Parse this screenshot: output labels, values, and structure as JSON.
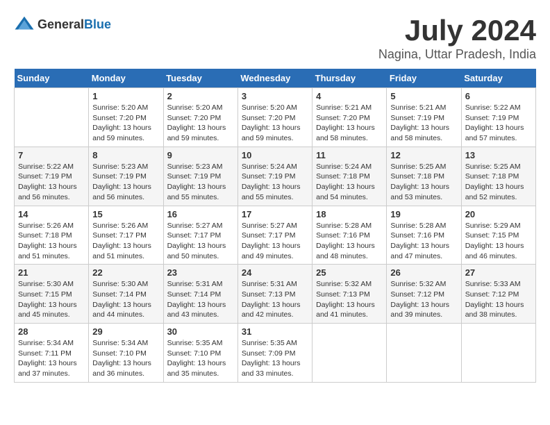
{
  "logo": {
    "general": "General",
    "blue": "Blue"
  },
  "title": "July 2024",
  "subtitle": "Nagina, Uttar Pradesh, India",
  "days_header": [
    "Sunday",
    "Monday",
    "Tuesday",
    "Wednesday",
    "Thursday",
    "Friday",
    "Saturday"
  ],
  "weeks": [
    [
      {
        "day": "",
        "info": ""
      },
      {
        "day": "1",
        "info": "Sunrise: 5:20 AM\nSunset: 7:20 PM\nDaylight: 13 hours\nand 59 minutes."
      },
      {
        "day": "2",
        "info": "Sunrise: 5:20 AM\nSunset: 7:20 PM\nDaylight: 13 hours\nand 59 minutes."
      },
      {
        "day": "3",
        "info": "Sunrise: 5:20 AM\nSunset: 7:20 PM\nDaylight: 13 hours\nand 59 minutes."
      },
      {
        "day": "4",
        "info": "Sunrise: 5:21 AM\nSunset: 7:20 PM\nDaylight: 13 hours\nand 58 minutes."
      },
      {
        "day": "5",
        "info": "Sunrise: 5:21 AM\nSunset: 7:19 PM\nDaylight: 13 hours\nand 58 minutes."
      },
      {
        "day": "6",
        "info": "Sunrise: 5:22 AM\nSunset: 7:19 PM\nDaylight: 13 hours\nand 57 minutes."
      }
    ],
    [
      {
        "day": "7",
        "info": "Sunrise: 5:22 AM\nSunset: 7:19 PM\nDaylight: 13 hours\nand 56 minutes."
      },
      {
        "day": "8",
        "info": "Sunrise: 5:23 AM\nSunset: 7:19 PM\nDaylight: 13 hours\nand 56 minutes."
      },
      {
        "day": "9",
        "info": "Sunrise: 5:23 AM\nSunset: 7:19 PM\nDaylight: 13 hours\nand 55 minutes."
      },
      {
        "day": "10",
        "info": "Sunrise: 5:24 AM\nSunset: 7:19 PM\nDaylight: 13 hours\nand 55 minutes."
      },
      {
        "day": "11",
        "info": "Sunrise: 5:24 AM\nSunset: 7:18 PM\nDaylight: 13 hours\nand 54 minutes."
      },
      {
        "day": "12",
        "info": "Sunrise: 5:25 AM\nSunset: 7:18 PM\nDaylight: 13 hours\nand 53 minutes."
      },
      {
        "day": "13",
        "info": "Sunrise: 5:25 AM\nSunset: 7:18 PM\nDaylight: 13 hours\nand 52 minutes."
      }
    ],
    [
      {
        "day": "14",
        "info": "Sunrise: 5:26 AM\nSunset: 7:18 PM\nDaylight: 13 hours\nand 51 minutes."
      },
      {
        "day": "15",
        "info": "Sunrise: 5:26 AM\nSunset: 7:17 PM\nDaylight: 13 hours\nand 51 minutes."
      },
      {
        "day": "16",
        "info": "Sunrise: 5:27 AM\nSunset: 7:17 PM\nDaylight: 13 hours\nand 50 minutes."
      },
      {
        "day": "17",
        "info": "Sunrise: 5:27 AM\nSunset: 7:17 PM\nDaylight: 13 hours\nand 49 minutes."
      },
      {
        "day": "18",
        "info": "Sunrise: 5:28 AM\nSunset: 7:16 PM\nDaylight: 13 hours\nand 48 minutes."
      },
      {
        "day": "19",
        "info": "Sunrise: 5:28 AM\nSunset: 7:16 PM\nDaylight: 13 hours\nand 47 minutes."
      },
      {
        "day": "20",
        "info": "Sunrise: 5:29 AM\nSunset: 7:15 PM\nDaylight: 13 hours\nand 46 minutes."
      }
    ],
    [
      {
        "day": "21",
        "info": "Sunrise: 5:30 AM\nSunset: 7:15 PM\nDaylight: 13 hours\nand 45 minutes."
      },
      {
        "day": "22",
        "info": "Sunrise: 5:30 AM\nSunset: 7:14 PM\nDaylight: 13 hours\nand 44 minutes."
      },
      {
        "day": "23",
        "info": "Sunrise: 5:31 AM\nSunset: 7:14 PM\nDaylight: 13 hours\nand 43 minutes."
      },
      {
        "day": "24",
        "info": "Sunrise: 5:31 AM\nSunset: 7:13 PM\nDaylight: 13 hours\nand 42 minutes."
      },
      {
        "day": "25",
        "info": "Sunrise: 5:32 AM\nSunset: 7:13 PM\nDaylight: 13 hours\nand 41 minutes."
      },
      {
        "day": "26",
        "info": "Sunrise: 5:32 AM\nSunset: 7:12 PM\nDaylight: 13 hours\nand 39 minutes."
      },
      {
        "day": "27",
        "info": "Sunrise: 5:33 AM\nSunset: 7:12 PM\nDaylight: 13 hours\nand 38 minutes."
      }
    ],
    [
      {
        "day": "28",
        "info": "Sunrise: 5:34 AM\nSunset: 7:11 PM\nDaylight: 13 hours\nand 37 minutes."
      },
      {
        "day": "29",
        "info": "Sunrise: 5:34 AM\nSunset: 7:10 PM\nDaylight: 13 hours\nand 36 minutes."
      },
      {
        "day": "30",
        "info": "Sunrise: 5:35 AM\nSunset: 7:10 PM\nDaylight: 13 hours\nand 35 minutes."
      },
      {
        "day": "31",
        "info": "Sunrise: 5:35 AM\nSunset: 7:09 PM\nDaylight: 13 hours\nand 33 minutes."
      },
      {
        "day": "",
        "info": ""
      },
      {
        "day": "",
        "info": ""
      },
      {
        "day": "",
        "info": ""
      }
    ]
  ]
}
